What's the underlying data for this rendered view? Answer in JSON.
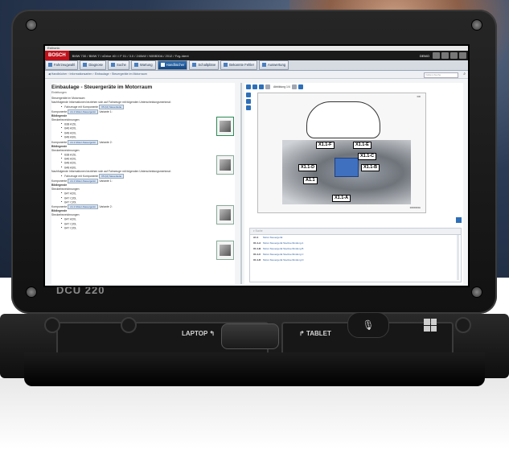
{
  "device": {
    "model": "DCU 220",
    "mode_left": "LAPTOP",
    "mode_right": "TABLET"
  },
  "app": {
    "window_title": "Esitronic",
    "brand": "BOSCH",
    "vehicle_info": "BMW 730 / BMW 7 / xDrive 40 i / F 01 / 3.0 / 240kW / N55B30A / 2012 / Fzg-Ident",
    "mode_label": "DEMO",
    "nav": [
      {
        "label": "Fahrzeugwahl",
        "icon": "car-icon"
      },
      {
        "label": "Diagnose",
        "icon": "diagnosis-icon"
      },
      {
        "label": "Suche",
        "icon": "search-icon"
      },
      {
        "label": "Wartung",
        "icon": "wrench-icon"
      },
      {
        "label": "Handbücher",
        "icon": "book-icon",
        "active": true
      },
      {
        "label": "Schaltpläne",
        "icon": "circuit-icon"
      },
      {
        "label": "Bekannte Fehler",
        "icon": "warning-icon"
      },
      {
        "label": "Auswertung",
        "icon": "chart-icon"
      }
    ],
    "breadcrumb": "Handbücher › Informationsarten › Einbaulage › Steuergeräte im Motorraum",
    "search_placeholder": "Volltext-Suche"
  },
  "document": {
    "title": "Einbaulage - Steuergeräte im Motorraum",
    "subtitle": "Einleitungen",
    "lines": [
      {
        "text": "Steuergeräte im Motorraum",
        "style": "plain"
      },
      {
        "text": "Nachfolgende Informationen beziehen sich auf Fahrzeuge mit folgenden Unterscheidungsmerkmal:",
        "style": "plain"
      },
      {
        "text": "Fahrzeuge mit Komponente",
        "tag": "X5 (I2) Steuerkette",
        "style": "blt"
      },
      {
        "text": "Komponente",
        "tag": "A1.1 Motor-Steuergerät",
        "suffix": ", Variante 1:",
        "style": "plain"
      },
      {
        "text": "Bildlegende",
        "style": "bold"
      },
      {
        "text": "Steckerbezeichnungen",
        "style": "plain"
      },
      {
        "text": "B38 A15L",
        "style": "blt"
      },
      {
        "text": "B46 A20L",
        "style": "blt"
      },
      {
        "text": "B48 A20L",
        "style": "blt"
      },
      {
        "text": "B48 A30L",
        "style": "blt"
      },
      {
        "text": "Komponente",
        "tag": "A1.1 Motor-Steuergerät",
        "suffix": ", Variante 2:",
        "style": "plain"
      },
      {
        "text": "Bildlegende",
        "style": "bold"
      },
      {
        "text": "Steckerbezeichnungen",
        "style": "plain"
      },
      {
        "text": "B38 A15L",
        "style": "blt"
      },
      {
        "text": "B46 A20L",
        "style": "blt"
      },
      {
        "text": "B48 A20L",
        "style": "blt"
      },
      {
        "text": "B48 A30L",
        "style": "blt"
      },
      {
        "text": "Nachfolgende Informationen beziehen sich auf Fahrzeuge mit folgenden Unterscheidungsmerkmal:",
        "style": "plain"
      },
      {
        "text": "Fahrzeuge mit Komponente",
        "tag": "X5 (I2) Steuerkette",
        "style": "blt"
      },
      {
        "text": "Komponente",
        "tag": "A1.1 Motor-Steuergerät",
        "suffix": ", Variante 1:",
        "style": "plain"
      },
      {
        "text": "Bildlegende",
        "style": "bold"
      },
      {
        "text": "Steckerbezeichnungen",
        "style": "plain"
      },
      {
        "text": "B47 A20L",
        "style": "blt"
      },
      {
        "text": "B47 C20L",
        "style": "blt"
      },
      {
        "text": "B47 C20L",
        "style": "blt"
      },
      {
        "text": "Komponente",
        "tag": "A1.1 Motor-Steuergerät",
        "suffix": ", Variante 2:",
        "style": "plain"
      },
      {
        "text": "Bildlegende",
        "style": "bold"
      },
      {
        "text": "Steckerbezeichnungen",
        "style": "plain"
      },
      {
        "text": "B47 A20L",
        "style": "blt"
      },
      {
        "text": "B47 C20L",
        "style": "blt"
      },
      {
        "text": "B47 C20L",
        "style": "blt"
      }
    ]
  },
  "viewer": {
    "page_label": "Abbildung 1/4",
    "figure_number": "000",
    "figure_id": "00000000A"
  },
  "callouts": [
    "X1.1-F",
    "X1.1-E",
    "X1.1-C",
    "X1.1-D",
    "X1.1-B",
    "A1.1",
    "X1.1-A"
  ],
  "legend": {
    "search_placeholder": "Suche",
    "rows": [
      {
        "id": "A1.1",
        "desc": "Motor-Steuergerät"
      },
      {
        "id": "X1.1-A",
        "desc": "Motor-Steuergerät Steckverbindung A"
      },
      {
        "id": "X1.1-B",
        "desc": "Motor-Steuergerät Steckverbindung B"
      },
      {
        "id": "X1.1-C",
        "desc": "Motor-Steuergerät Steckverbindung C"
      },
      {
        "id": "X1.1-D",
        "desc": "Motor-Steuergerät Steckverbindung D"
      }
    ]
  }
}
